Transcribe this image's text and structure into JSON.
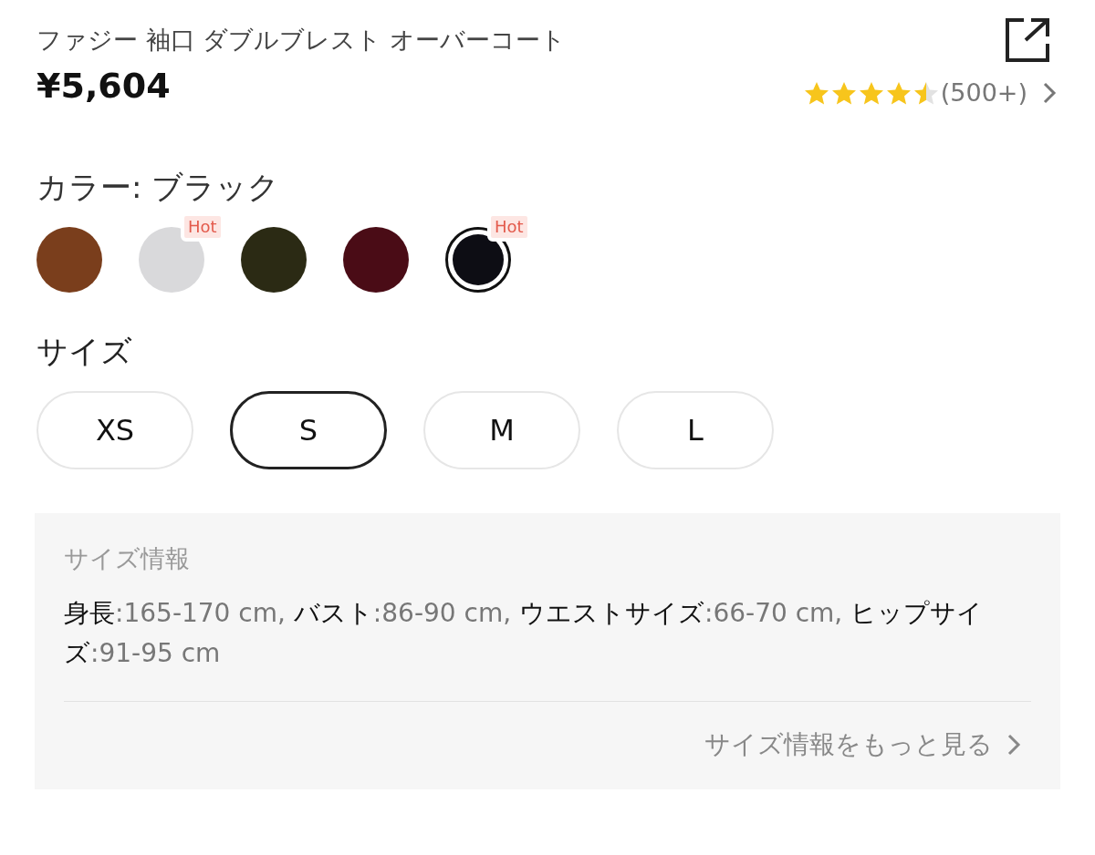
{
  "product": {
    "title": "ファジー 袖口 ダブルブレスト オーバーコート",
    "price": "¥5,604",
    "stars": 4.5,
    "review_count": "(500+)"
  },
  "color": {
    "label": "カラー: ブラック",
    "swatches": [
      {
        "color": "#7a3e1c",
        "selected": false
      },
      {
        "color": "#d9d9db",
        "selected": false,
        "badge": "Hot"
      },
      {
        "color": "#2b2a14",
        "selected": false
      },
      {
        "color": "#4a0c16",
        "selected": false
      },
      {
        "color": "#0d0d14",
        "selected": true,
        "badge": "Hot"
      }
    ]
  },
  "size": {
    "label": "サイズ",
    "options": [
      {
        "label": "XS",
        "selected": false
      },
      {
        "label": "S",
        "selected": true
      },
      {
        "label": "M",
        "selected": false
      },
      {
        "label": "L",
        "selected": false
      }
    ]
  },
  "size_info": {
    "title": "サイズ情報",
    "measurements": [
      {
        "label": "身長",
        "value": ":165-170 cm,"
      },
      {
        "label": "バスト",
        "value": ":86-90 cm,"
      },
      {
        "label": "ウエストサイズ",
        "value": ":66-70 cm,"
      },
      {
        "label": "ヒップサイズ",
        "value": ":91-95 cm"
      }
    ],
    "more_link": "サイズ情報をもっと見る"
  }
}
